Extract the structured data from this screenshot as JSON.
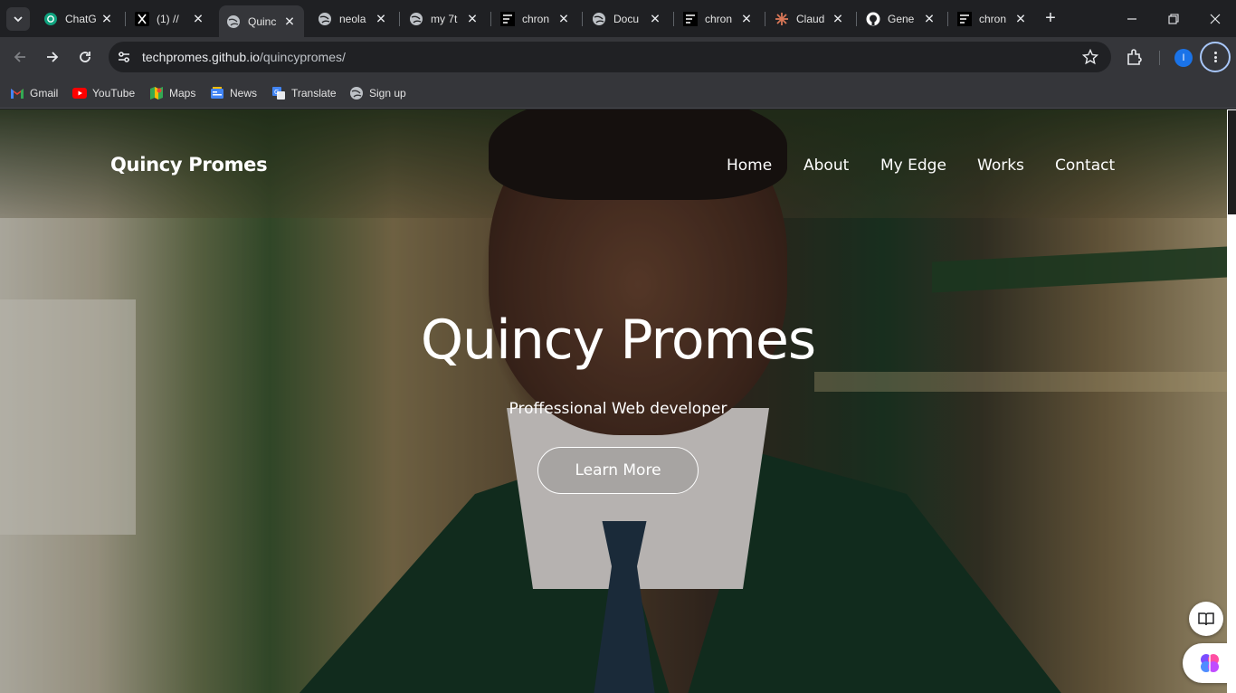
{
  "browser": {
    "tabs": [
      {
        "title": "ChatG",
        "icon": "chatgpt-icon",
        "active": false
      },
      {
        "title": "(1) //",
        "icon": "x-icon",
        "active": false
      },
      {
        "title": "Quinc",
        "icon": "globe-icon",
        "active": true
      },
      {
        "title": "neola",
        "icon": "globe-icon",
        "active": false
      },
      {
        "title": "my 7t",
        "icon": "globe-icon",
        "active": false
      },
      {
        "title": "chron",
        "icon": "doc-icon",
        "active": false
      },
      {
        "title": "Docu",
        "icon": "globe-icon",
        "active": false
      },
      {
        "title": "chron",
        "icon": "doc-icon",
        "active": false
      },
      {
        "title": "Claud",
        "icon": "claude-icon",
        "active": false
      },
      {
        "title": "Gene",
        "icon": "github-icon",
        "active": false
      },
      {
        "title": "chron",
        "icon": "doc-icon",
        "active": false
      }
    ],
    "close_glyph": "✕",
    "new_tab_glyph": "+",
    "url_host": "techpromes.github.io",
    "url_path": "/quincypromes/",
    "avatar_letter": "I",
    "bookmarks": [
      {
        "label": "Gmail",
        "icon": "gmail-icon"
      },
      {
        "label": "YouTube",
        "icon": "youtube-icon"
      },
      {
        "label": "Maps",
        "icon": "maps-icon"
      },
      {
        "label": "News",
        "icon": "news-icon"
      },
      {
        "label": "Translate",
        "icon": "translate-icon"
      },
      {
        "label": "Sign up",
        "icon": "globe-icon"
      }
    ]
  },
  "site": {
    "brand": "Quincy Promes",
    "nav": [
      "Home",
      "About",
      "My Edge",
      "Works",
      "Contact"
    ],
    "hero_title": "Quincy Promes",
    "hero_subtitle": "Proffessional Web developer",
    "cta_label": "Learn More"
  },
  "colors": {
    "chrome_bg": "#35363a",
    "tabstrip_bg": "#1f2023",
    "text_white": "#ffffff",
    "focus_ring": "#a8c7fa",
    "avatar_blue": "#1a73e8"
  }
}
